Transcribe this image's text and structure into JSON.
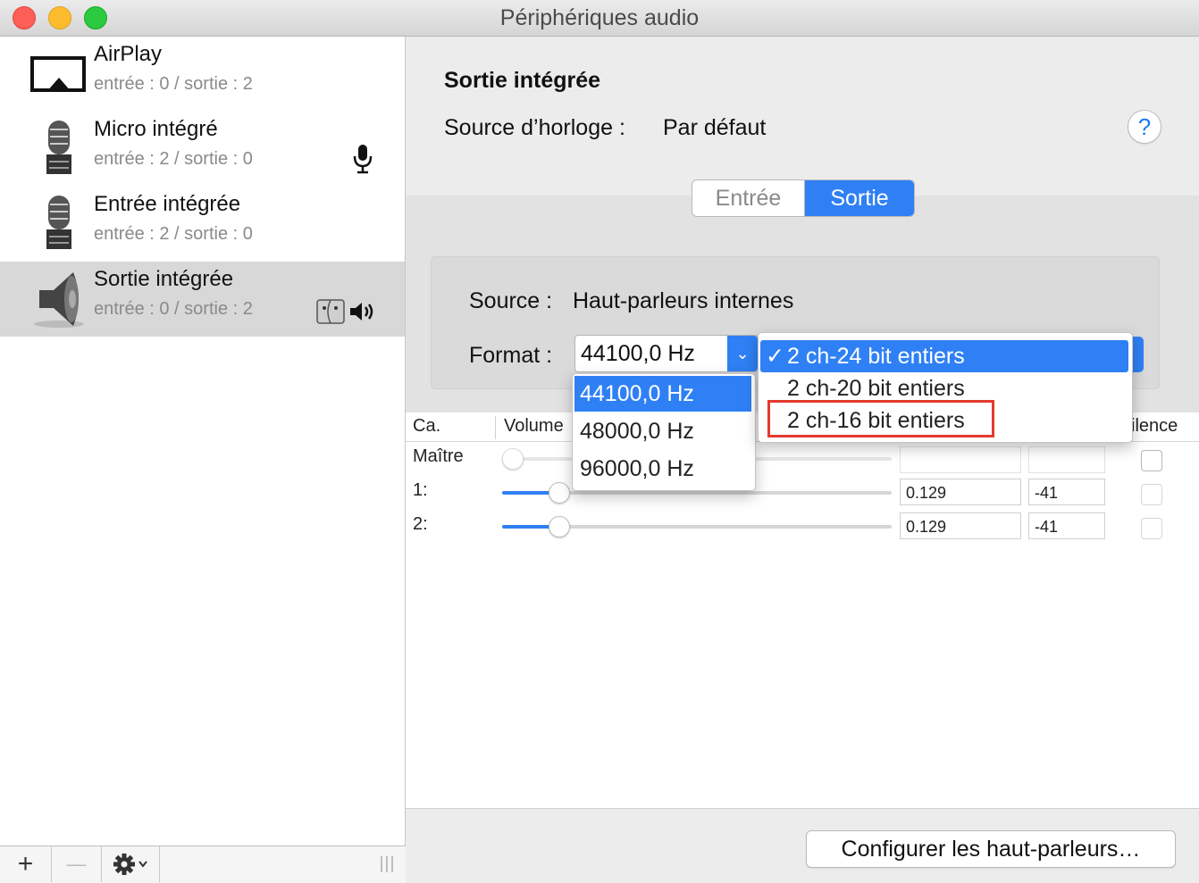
{
  "window": {
    "title": "Périphériques audio"
  },
  "sidebar": {
    "devices": [
      {
        "name": "AirPlay",
        "io": "entrée : 0 / sortie : 2",
        "icon": "airplay-icon"
      },
      {
        "name": "Micro intégré",
        "io": "entrée : 2 / sortie : 0",
        "icon": "microphone-icon",
        "badge": "microphone-badge-icon"
      },
      {
        "name": "Entrée intégrée",
        "io": "entrée : 2 / sortie : 0",
        "icon": "microphone-icon"
      },
      {
        "name": "Sortie intégrée",
        "io": "entrée : 0 / sortie : 2",
        "icon": "speaker-icon",
        "badge": "finder-icon + speaker-volume-icon",
        "selected": true
      }
    ],
    "bottom": {
      "add": "+",
      "remove": "—"
    }
  },
  "detail": {
    "title": "Sortie intégrée",
    "clock_label": "Source d’horloge :",
    "clock_value": "Par défaut",
    "help": "?",
    "tabs": {
      "input": "Entrée",
      "output": "Sortie",
      "active": "output"
    },
    "source_label": "Source :",
    "source_value": "Haut-parleurs internes",
    "format_label": "Format :",
    "format_value": "44100,0 Hz",
    "table": {
      "headers": {
        "channel": "Ca.",
        "volume": "Volume",
        "mute": "ilence"
      },
      "rows": [
        {
          "label": "Maître",
          "value": "",
          "db": "",
          "volume": 0,
          "enabled": false
        },
        {
          "label": "1:",
          "value": "0.129",
          "db": "-41",
          "volume": 0.15,
          "enabled": true
        },
        {
          "label": "2:",
          "value": "0.129",
          "db": "-41",
          "volume": 0.15,
          "enabled": true
        }
      ]
    },
    "configure_button": "Configurer les haut-parleurs…"
  },
  "popups": {
    "sample_rates": [
      "44100,0 Hz",
      "48000,0 Hz",
      "96000,0 Hz"
    ],
    "sample_rate_selected": 0,
    "bit_formats": [
      "2 ch-24 bit entiers",
      "2 ch-20 bit entiers",
      "2 ch-16 bit entiers"
    ],
    "bit_format_selected": 0,
    "checkmark": "✓",
    "highlighted_option": "2 ch-16 bit entiers"
  },
  "colors": {
    "accent": "#2f80f5",
    "highlight": "#e33a2c"
  }
}
